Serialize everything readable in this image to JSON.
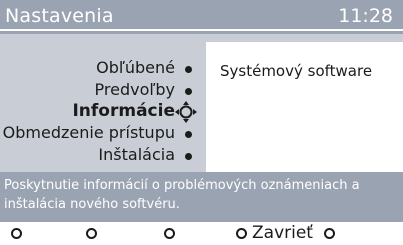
{
  "header": {
    "title": "Nastavenia",
    "time": "11:28"
  },
  "menu": {
    "items": [
      {
        "label": "Obľúbené",
        "active": false
      },
      {
        "label": "Predvoľby",
        "active": false
      },
      {
        "label": "Informácie",
        "active": true
      },
      {
        "label": "Obmedzenie prístupu",
        "active": false
      },
      {
        "label": "Inštalácia",
        "active": false
      }
    ]
  },
  "info": {
    "text": "Systémový software"
  },
  "help": {
    "text": "Poskytnutie informácií o problémových oznámeniach a inštalácia nového softvéru."
  },
  "footer": {
    "close_label": "Zavrieť"
  },
  "colors": {
    "bar": "#9aa3b1",
    "panel": "#c9ced6",
    "text": "#1b1b1b"
  }
}
